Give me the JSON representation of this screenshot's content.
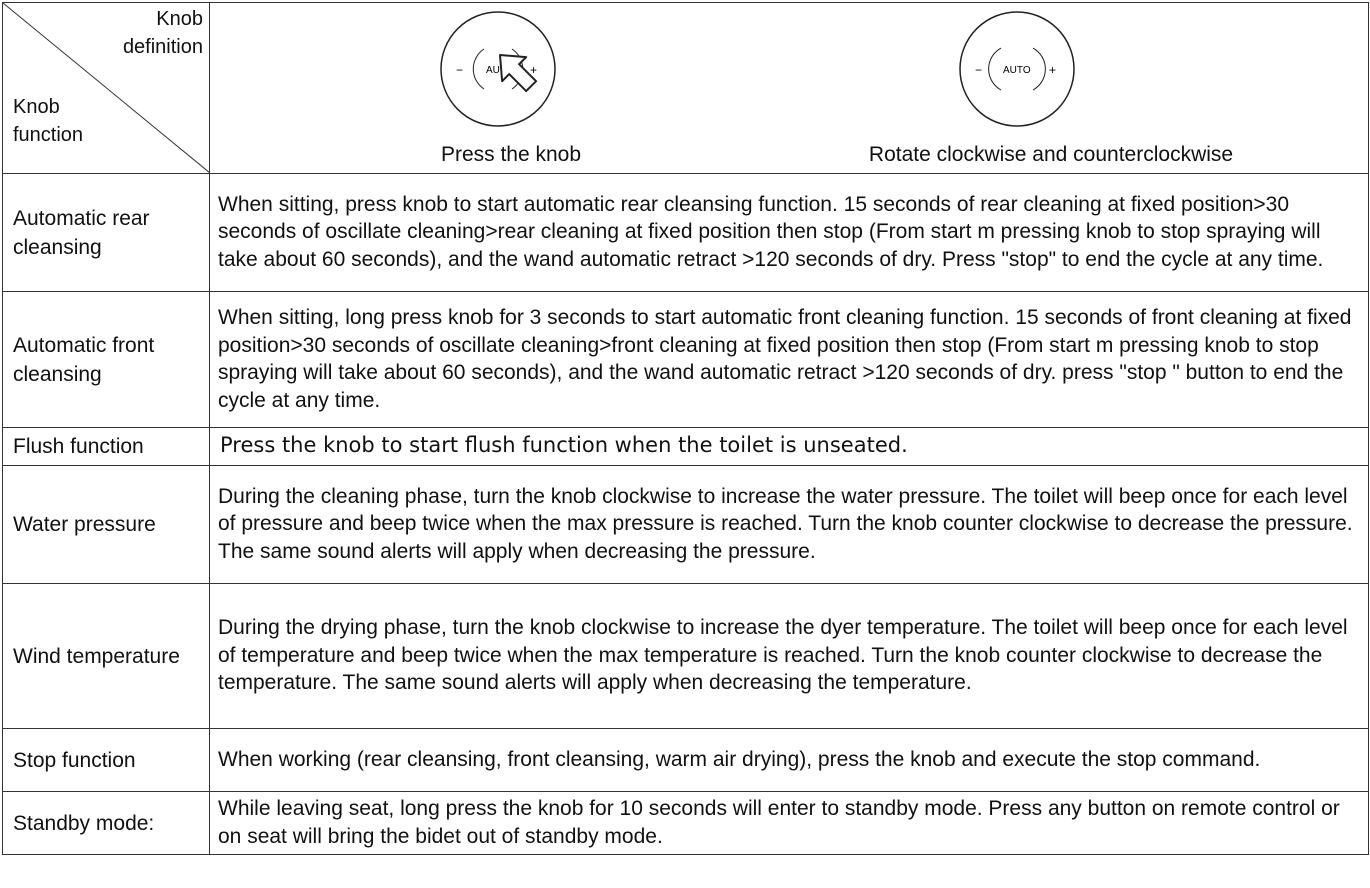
{
  "header": {
    "corner_top_line1": "Knob",
    "corner_top_line2": "definition",
    "corner_bottom_line1": "Knob",
    "corner_bottom_line2": "function",
    "press_caption": "Press the knob",
    "rotate_caption": "Rotate clockwise and counterclockwise",
    "press_knob": {
      "minus": "−",
      "label": "AU",
      "plus": "+"
    },
    "rotate_knob": {
      "minus": "−",
      "label": "AUTO",
      "plus": "+"
    }
  },
  "rows": [
    {
      "function": "Automatic rear cleansing",
      "description": "When sitting, press knob to start automatic rear cleansing function. 15 seconds of rear cleaning at fixed position>30 seconds of oscillate cleaning>rear cleaning at fixed position then stop (From start m pressing knob to stop spraying will take about 60 seconds), and the wand automatic retract >120 seconds of dry. Press \"stop\" to end the cycle at any time."
    },
    {
      "function": "Automatic front cleansing",
      "description": "When sitting, long press knob for 3 seconds to start automatic front cleaning function. 15 seconds of front cleaning at fixed position>30 seconds of oscillate cleaning>front cleaning at fixed position then stop (From start m pressing knob to stop spraying will take about 60 seconds), and the wand automatic retract >120 seconds of dry. press \"stop \" button to end the cycle at any time."
    },
    {
      "function": "Flush function",
      "description": "Press the knob to start flush function when the toilet is unseated."
    },
    {
      "function": "Water pressure",
      "description": "During the cleaning phase, turn the knob clockwise to increase the water pressure. The toilet will beep once for each level of pressure and beep twice when the max pressure is reached. Turn the knob counter clockwise to decrease the pressure. The same sound alerts will apply when decreasing the pressure."
    },
    {
      "function": "Wind temperature",
      "description": "During the drying phase, turn the knob clockwise to increase the dyer temperature. The toilet will beep once for each level of temperature and beep twice when the max temperature is reached. Turn the knob counter clockwise to decrease the temperature. The same sound alerts will apply when decreasing the temperature."
    },
    {
      "function": "Stop function",
      "description": "When working (rear cleansing, front cleansing, warm air drying), press the knob and execute the stop command."
    },
    {
      "function": "Standby mode:",
      "description": "While leaving seat, long press the knob for 10 seconds will enter to standby mode. Press any button on remote control or on seat will bring the bidet out of standby mode."
    }
  ]
}
